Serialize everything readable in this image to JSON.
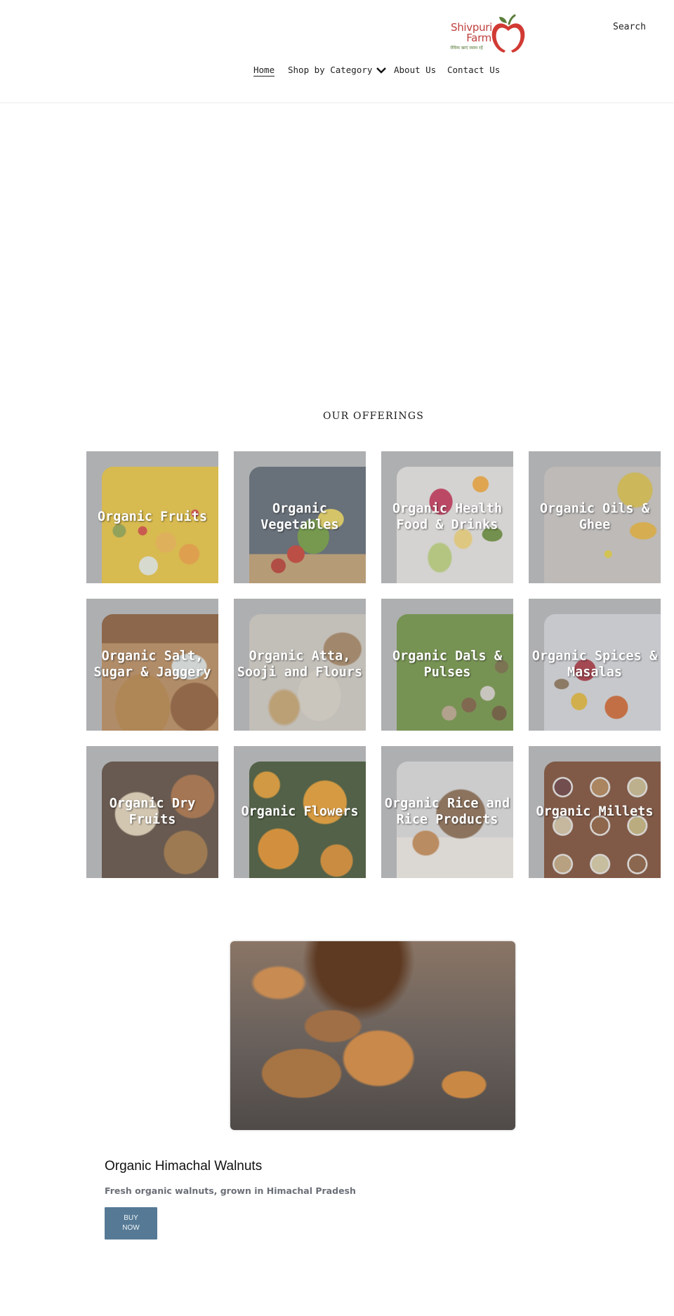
{
  "header": {
    "logo": {
      "line1": "Shivpuri",
      "line2": "Farm",
      "tagline": "जैविक खाएं स्वस्थ रहें",
      "brand_color": "#c0403f",
      "leaf_color": "#5b7d3b"
    },
    "search_label": "Search",
    "nav": [
      {
        "label": "Home",
        "active": true
      },
      {
        "label": "Shop by Category",
        "has_dropdown": true,
        "icon": "chevron-down-icon"
      },
      {
        "label": "About Us"
      },
      {
        "label": "Contact Us"
      }
    ]
  },
  "offerings": {
    "title": "OUR OFFERINGS",
    "categories": [
      {
        "label": "Organic Fruits"
      },
      {
        "label": "Organic Vegetables"
      },
      {
        "label": "Organic Health Food & Drinks"
      },
      {
        "label": "Organic Oils & Ghee"
      },
      {
        "label": "Organic Salt, Sugar & Jaggery"
      },
      {
        "label": "Organic Atta, Sooji and Flours"
      },
      {
        "label": "Organic Dals & Pulses"
      },
      {
        "label": "Organic Spices & Masalas"
      },
      {
        "label": "Organic Dry Fruits"
      },
      {
        "label": "Organic Flowers"
      },
      {
        "label": "Organic Rice and Rice Products"
      },
      {
        "label": "Organic Millets"
      }
    ]
  },
  "featured": {
    "title": "Organic Himachal Walnuts",
    "description": "Fresh organic walnuts, grown in Himachal Pradesh",
    "button_label": "BUY NOW",
    "button_color": "#567a96"
  }
}
